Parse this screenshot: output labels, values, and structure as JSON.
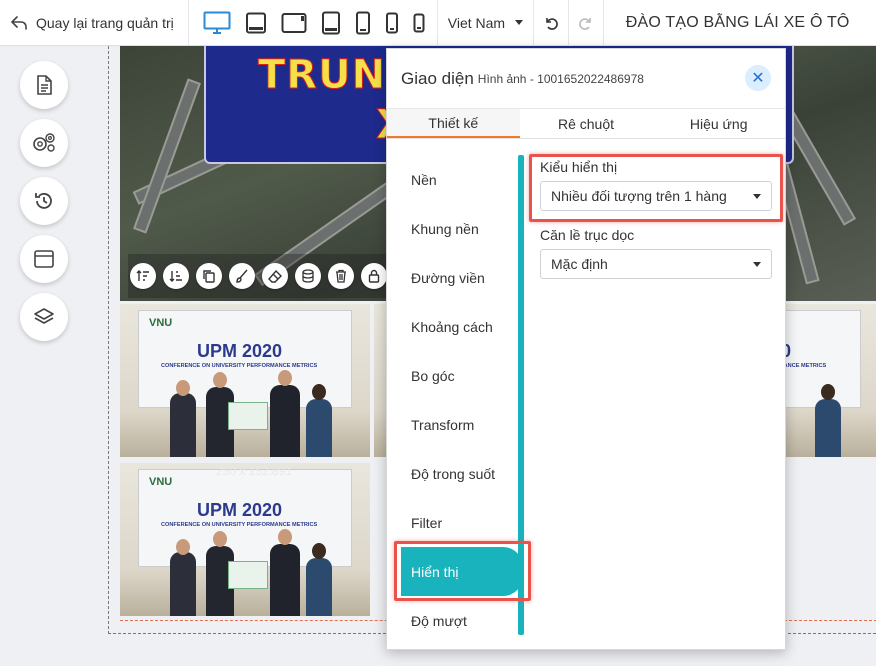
{
  "topbar": {
    "back_label": "Quay lại trang quản trị",
    "devices": [
      "desktop-icon",
      "tablet-landscape-icon",
      "tablet-wide-icon",
      "tablet-icon",
      "phone-large-icon",
      "phone-icon",
      "phone-small-icon"
    ],
    "language": "Viet Nam",
    "site_title": "ĐÀO TẠO BẰNG LÁI XE Ô TÔ"
  },
  "rail": {
    "buttons": [
      "document-icon",
      "settings-icon",
      "history-icon",
      "window-icon",
      "layers-icon"
    ]
  },
  "canvas": {
    "banner_line1": "TRUNG",
    "banner_line2": "X",
    "dimension_label": "250 x 152.891",
    "photo_logo": "VNU",
    "photo_upm": "UPM 2020",
    "photo_conference": "CONFERENCE ON UNIVERSITY PERFORMANCE METRICS",
    "toolbar_icons": [
      "sort-up-icon",
      "sort-down-icon",
      "copy-icon",
      "brush-icon",
      "eraser-icon",
      "database-icon",
      "trash-icon",
      "lock-icon"
    ]
  },
  "panel": {
    "title": "Giao diện",
    "subtitle": "Hình ảnh - 1001652022486978",
    "tabs": [
      "Thiết kế",
      "Rê chuột",
      "Hiệu ứng"
    ],
    "menu": [
      "Nền",
      "Khung nền",
      "Đường viền",
      "Khoảng cách",
      "Bo góc",
      "Transform",
      "Độ trong suốt",
      "Filter",
      "Hiển thị",
      "Độ mượt"
    ],
    "active_menu": "Hiển thị",
    "display_label": "Kiểu hiển thị",
    "display_value": "Nhiều đối tượng trên 1 hàng",
    "align_label": "Căn lề trục dọc",
    "align_value": "Mặc định"
  },
  "colors": {
    "accent": "#19b3bd",
    "highlight": "#e8534c",
    "tab_underline": "#f07a2c",
    "device_active": "#2a8ad8"
  }
}
